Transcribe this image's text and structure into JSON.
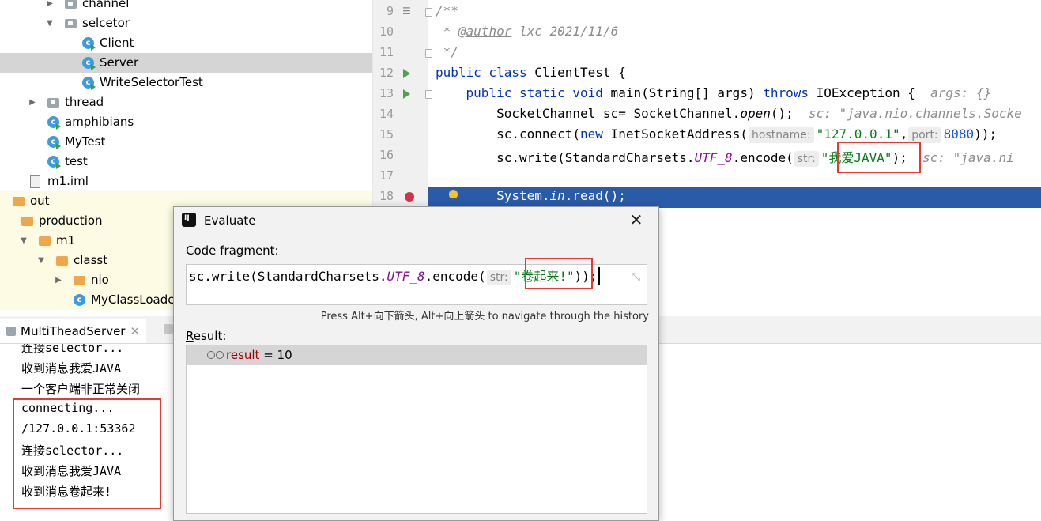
{
  "tree": [
    {
      "label": "channel",
      "kind": "package",
      "indent": 2,
      "arrow": "right"
    },
    {
      "label": "selcetor",
      "kind": "package",
      "indent": 2,
      "arrow": "down"
    },
    {
      "label": "Client",
      "kind": "class",
      "indent": 3,
      "arrow": ""
    },
    {
      "label": "Server",
      "kind": "class",
      "indent": 3,
      "arrow": "",
      "selected": true
    },
    {
      "label": "WriteSelectorTest",
      "kind": "class",
      "indent": 3,
      "arrow": ""
    },
    {
      "label": "thread",
      "kind": "package",
      "indent": 1,
      "arrow": "right"
    },
    {
      "label": "amphibians",
      "kind": "class",
      "indent": 1,
      "arrow": ""
    },
    {
      "label": "MyTest",
      "kind": "class",
      "indent": 1,
      "arrow": ""
    },
    {
      "label": "test",
      "kind": "class",
      "indent": 1,
      "arrow": ""
    },
    {
      "label": "m1.iml",
      "kind": "file",
      "indent": 0,
      "arrow": ""
    },
    {
      "label": "out",
      "kind": "folder",
      "indent": -1,
      "arrow": "",
      "yellow": true
    },
    {
      "label": "production",
      "kind": "folder",
      "indent": -0.5,
      "arrow": "",
      "yellow": true
    },
    {
      "label": "m1",
      "kind": "folder",
      "indent": 0.5,
      "arrow": "down",
      "yellow": true
    },
    {
      "label": "classt",
      "kind": "folder",
      "indent": 1.5,
      "arrow": "down",
      "yellow": true
    },
    {
      "label": "nio",
      "kind": "folder",
      "indent": 2.5,
      "arrow": "right",
      "yellow": true
    },
    {
      "label": "MyClassLoader.c",
      "kind": "class",
      "indent": 2.5,
      "arrow": "",
      "yellow": true
    }
  ],
  "editor": {
    "line_numbers": [
      "9",
      "10",
      "11",
      "12",
      "13",
      "14",
      "15",
      "16",
      "17",
      "18"
    ],
    "l9": "/**",
    "l10_a": " * ",
    "l10_tag": "@author",
    "l10_b": " lxc 2021/11/6",
    "l11": " */",
    "l12_kw": "public class",
    "l12_rest": " ClientTest {",
    "l13_kw1": "    public static void",
    "l13_rest": " main(String[] args) ",
    "l13_kw2": "throws",
    "l13_rest2": " IOException {",
    "l13_hint": "  args: {}",
    "l14_a": "        SocketChannel sc= SocketChannel.",
    "l14_it": "open",
    "l14_b": "();",
    "l14_hint": "  sc: \"java.nio.channels.Socke",
    "l15_a": "        sc.connect(",
    "l15_kw": "new",
    "l15_b": " InetSocketAddress(",
    "l15_h1": "hostname:",
    "l15_s": "\"127.0.0.1\"",
    "l15_c": ",",
    "l15_h2": "port:",
    "l15_n": "8080",
    "l15_d": "));",
    "l16_a": "        sc.write(StandardCharsets.",
    "l16_f": "UTF_8",
    "l16_b": ".encode(",
    "l16_h": "str:",
    "l16_s": "\"我爱JAVA\"",
    "l16_c": ");",
    "l16_hint": "  sc: \"java.ni",
    "l18_a": "        System.",
    "l18_f": "in",
    "l18_b": ".read();"
  },
  "run": {
    "tab_label": "MultiTheadServer",
    "tab_close": "✕",
    "console": [
      "连接selector...",
      "收到消息我爱JAVA",
      "一个客户端非正常关闭",
      "connecting...",
      "/127.0.0.1:53362",
      "连接selector...",
      "收到消息我爱JAVA",
      "收到消息卷起来!"
    ]
  },
  "dialog": {
    "title": "Evaluate",
    "close": "✕",
    "code_label": "Code fragment:",
    "code_a": "sc.write(StandardCharsets.",
    "code_f": "UTF_8",
    "code_b": ".encode(",
    "code_h": "str:",
    "code_s": "\"卷起来!\"",
    "code_c": "));",
    "history_hint": "Press Alt+向下箭头, Alt+向上箭头 to navigate through the history",
    "result_label_u": "R",
    "result_label_rest": "esult:",
    "result_name": "result",
    "result_value": " = 10"
  },
  "colors": {
    "accent_line": "#2a5ba8",
    "annotation_box": "#e53935"
  }
}
